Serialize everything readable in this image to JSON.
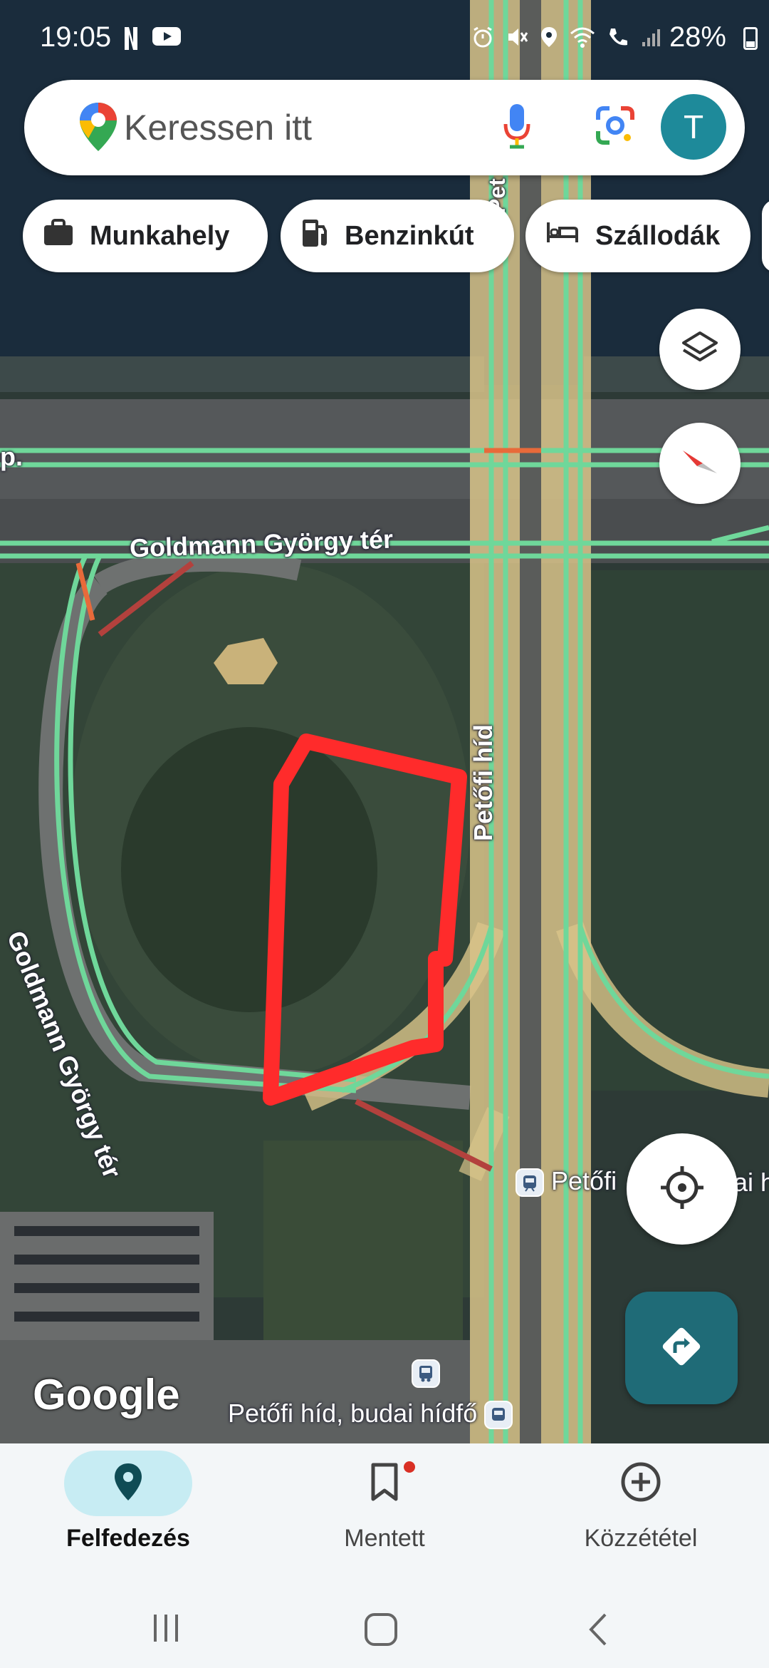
{
  "status_bar": {
    "time": "19:05",
    "battery": "28%",
    "left_icons": [
      "netflix-icon",
      "youtube-icon"
    ],
    "right_icons": [
      "alarm-icon",
      "mute-icon",
      "location-icon",
      "wifi-icon",
      "wifi-call-icon",
      "signal-icon",
      "battery-icon"
    ]
  },
  "search": {
    "placeholder": "Keressen itt",
    "avatar_letter": "T"
  },
  "chips": [
    {
      "label": "Munkahely",
      "icon": "briefcase-icon"
    },
    {
      "label": "Benzinkút",
      "icon": "gas-station-icon"
    },
    {
      "label": "Szállodák",
      "icon": "bed-icon"
    }
  ],
  "map": {
    "labels": {
      "street_top": "Goldmann György tér",
      "street_left": "Goldmann György tér",
      "bridge": "Petőfi híd",
      "bridge_top": "Pet",
      "left_edge": "p.",
      "stop_1": "Petőfi",
      "stop_1_tail": "ai h",
      "stop_2": "Petőfi híd, budai hídfő"
    },
    "logo": "Google",
    "colors": {
      "traffic_green": "#6fd79a",
      "traffic_red": "#b3413d",
      "highway": "#e3c88a",
      "drawn_outline": "#ff2b2b"
    }
  },
  "bottom_nav": {
    "items": [
      {
        "label": "Felfedezés",
        "icon": "explore-pin-icon",
        "active": true
      },
      {
        "label": "Mentett",
        "icon": "bookmark-icon",
        "active": false
      },
      {
        "label": "Közzététel",
        "icon": "add-circle-icon",
        "active": false
      }
    ]
  },
  "system_nav": [
    "recents-icon",
    "home-icon",
    "back-icon"
  ]
}
